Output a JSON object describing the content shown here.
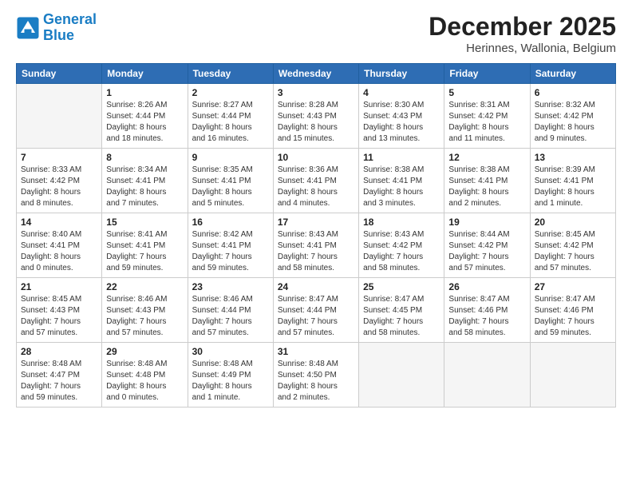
{
  "logo": {
    "line1": "General",
    "line2": "Blue"
  },
  "header": {
    "month": "December 2025",
    "location": "Herinnes, Wallonia, Belgium"
  },
  "weekdays": [
    "Sunday",
    "Monday",
    "Tuesday",
    "Wednesday",
    "Thursday",
    "Friday",
    "Saturday"
  ],
  "weeks": [
    [
      {
        "day": "",
        "info": ""
      },
      {
        "day": "1",
        "info": "Sunrise: 8:26 AM\nSunset: 4:44 PM\nDaylight: 8 hours\nand 18 minutes."
      },
      {
        "day": "2",
        "info": "Sunrise: 8:27 AM\nSunset: 4:44 PM\nDaylight: 8 hours\nand 16 minutes."
      },
      {
        "day": "3",
        "info": "Sunrise: 8:28 AM\nSunset: 4:43 PM\nDaylight: 8 hours\nand 15 minutes."
      },
      {
        "day": "4",
        "info": "Sunrise: 8:30 AM\nSunset: 4:43 PM\nDaylight: 8 hours\nand 13 minutes."
      },
      {
        "day": "5",
        "info": "Sunrise: 8:31 AM\nSunset: 4:42 PM\nDaylight: 8 hours\nand 11 minutes."
      },
      {
        "day": "6",
        "info": "Sunrise: 8:32 AM\nSunset: 4:42 PM\nDaylight: 8 hours\nand 9 minutes."
      }
    ],
    [
      {
        "day": "7",
        "info": "Sunrise: 8:33 AM\nSunset: 4:42 PM\nDaylight: 8 hours\nand 8 minutes."
      },
      {
        "day": "8",
        "info": "Sunrise: 8:34 AM\nSunset: 4:41 PM\nDaylight: 8 hours\nand 7 minutes."
      },
      {
        "day": "9",
        "info": "Sunrise: 8:35 AM\nSunset: 4:41 PM\nDaylight: 8 hours\nand 5 minutes."
      },
      {
        "day": "10",
        "info": "Sunrise: 8:36 AM\nSunset: 4:41 PM\nDaylight: 8 hours\nand 4 minutes."
      },
      {
        "day": "11",
        "info": "Sunrise: 8:38 AM\nSunset: 4:41 PM\nDaylight: 8 hours\nand 3 minutes."
      },
      {
        "day": "12",
        "info": "Sunrise: 8:38 AM\nSunset: 4:41 PM\nDaylight: 8 hours\nand 2 minutes."
      },
      {
        "day": "13",
        "info": "Sunrise: 8:39 AM\nSunset: 4:41 PM\nDaylight: 8 hours\nand 1 minute."
      }
    ],
    [
      {
        "day": "14",
        "info": "Sunrise: 8:40 AM\nSunset: 4:41 PM\nDaylight: 8 hours\nand 0 minutes."
      },
      {
        "day": "15",
        "info": "Sunrise: 8:41 AM\nSunset: 4:41 PM\nDaylight: 7 hours\nand 59 minutes."
      },
      {
        "day": "16",
        "info": "Sunrise: 8:42 AM\nSunset: 4:41 PM\nDaylight: 7 hours\nand 59 minutes."
      },
      {
        "day": "17",
        "info": "Sunrise: 8:43 AM\nSunset: 4:41 PM\nDaylight: 7 hours\nand 58 minutes."
      },
      {
        "day": "18",
        "info": "Sunrise: 8:43 AM\nSunset: 4:42 PM\nDaylight: 7 hours\nand 58 minutes."
      },
      {
        "day": "19",
        "info": "Sunrise: 8:44 AM\nSunset: 4:42 PM\nDaylight: 7 hours\nand 57 minutes."
      },
      {
        "day": "20",
        "info": "Sunrise: 8:45 AM\nSunset: 4:42 PM\nDaylight: 7 hours\nand 57 minutes."
      }
    ],
    [
      {
        "day": "21",
        "info": "Sunrise: 8:45 AM\nSunset: 4:43 PM\nDaylight: 7 hours\nand 57 minutes."
      },
      {
        "day": "22",
        "info": "Sunrise: 8:46 AM\nSunset: 4:43 PM\nDaylight: 7 hours\nand 57 minutes."
      },
      {
        "day": "23",
        "info": "Sunrise: 8:46 AM\nSunset: 4:44 PM\nDaylight: 7 hours\nand 57 minutes."
      },
      {
        "day": "24",
        "info": "Sunrise: 8:47 AM\nSunset: 4:44 PM\nDaylight: 7 hours\nand 57 minutes."
      },
      {
        "day": "25",
        "info": "Sunrise: 8:47 AM\nSunset: 4:45 PM\nDaylight: 7 hours\nand 58 minutes."
      },
      {
        "day": "26",
        "info": "Sunrise: 8:47 AM\nSunset: 4:46 PM\nDaylight: 7 hours\nand 58 minutes."
      },
      {
        "day": "27",
        "info": "Sunrise: 8:47 AM\nSunset: 4:46 PM\nDaylight: 7 hours\nand 59 minutes."
      }
    ],
    [
      {
        "day": "28",
        "info": "Sunrise: 8:48 AM\nSunset: 4:47 PM\nDaylight: 7 hours\nand 59 minutes."
      },
      {
        "day": "29",
        "info": "Sunrise: 8:48 AM\nSunset: 4:48 PM\nDaylight: 8 hours\nand 0 minutes."
      },
      {
        "day": "30",
        "info": "Sunrise: 8:48 AM\nSunset: 4:49 PM\nDaylight: 8 hours\nand 1 minute."
      },
      {
        "day": "31",
        "info": "Sunrise: 8:48 AM\nSunset: 4:50 PM\nDaylight: 8 hours\nand 2 minutes."
      },
      {
        "day": "",
        "info": ""
      },
      {
        "day": "",
        "info": ""
      },
      {
        "day": "",
        "info": ""
      }
    ]
  ]
}
